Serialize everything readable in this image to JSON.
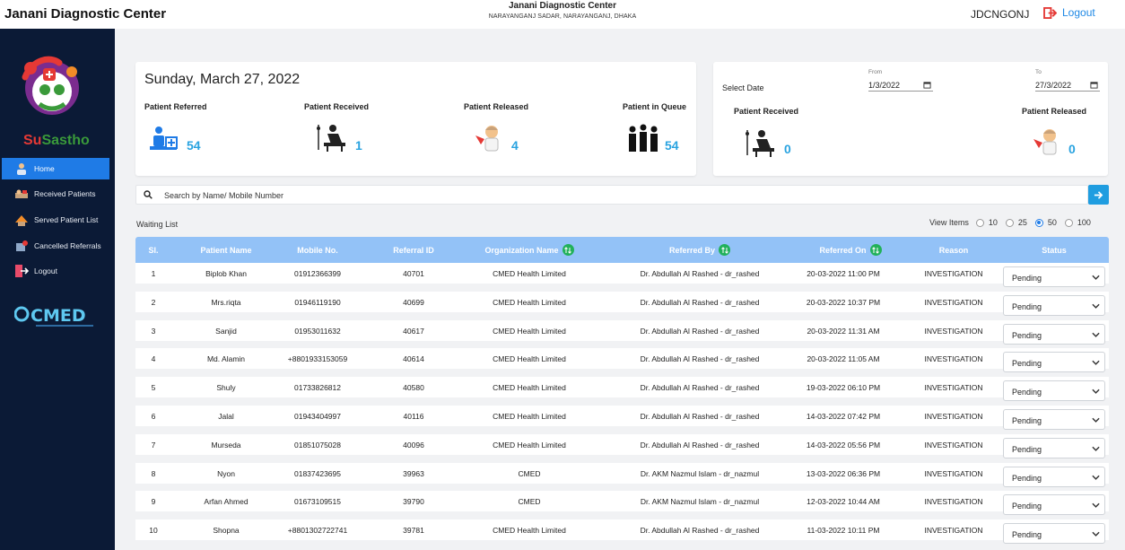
{
  "header": {
    "app_title": "Janani Diagnostic Center",
    "center_name": "Janani Diagnostic Center",
    "center_address": "NARAYANGANJ SADAR, NARAYANGANJ, DHAKA",
    "user_code": "JDCNGONJ",
    "logout_label": "Logout"
  },
  "sidebar": {
    "brand_a": "Su",
    "brand_b": "Sastho",
    "items": [
      {
        "label": "Home",
        "icon": "home-user-icon",
        "active": true
      },
      {
        "label": "Received Patients",
        "icon": "received-patients-icon"
      },
      {
        "label": "Served Patient List",
        "icon": "served-patient-icon"
      },
      {
        "label": "Cancelled Referrals",
        "icon": "cancelled-referrals-icon"
      },
      {
        "label": "Logout",
        "icon": "logout-icon"
      }
    ],
    "footer_logo": "CMED"
  },
  "summary": {
    "date": "Sunday, March 27, 2022",
    "stats": [
      {
        "label": "Patient Referred",
        "value": "54",
        "icon": "patient-referred-icon"
      },
      {
        "label": "Patient Received",
        "value": "1",
        "icon": "patient-received-icon"
      },
      {
        "label": "Patient Released",
        "value": "4",
        "icon": "patient-released-icon"
      },
      {
        "label": "Patient in Queue",
        "value": "54",
        "icon": "patient-queue-icon"
      }
    ]
  },
  "range": {
    "select_date_label": "Select Date",
    "from_label": "From",
    "from_value": "1/3/2022",
    "to_label": "To",
    "to_value": "27/3/2022",
    "received_label": "Patient Received",
    "received_value": "0",
    "released_label": "Patient Released",
    "released_value": "0"
  },
  "search": {
    "placeholder": "Search by Name/ Mobile Number"
  },
  "list": {
    "title": "Waiting List",
    "view_items_label": "View Items",
    "view_options": [
      "10",
      "25",
      "50",
      "100"
    ],
    "view_selected": "50"
  },
  "table": {
    "columns": [
      "Sl.",
      "Patient Name",
      "Mobile No.",
      "Referral ID",
      "Organization Name",
      "Referred By",
      "Referred On",
      "Reason",
      "Status"
    ],
    "rows": [
      {
        "sl": "1",
        "name": "Biplob Khan",
        "mobile": "01912366399",
        "ref_id": "40701",
        "org": "CMED Health Limited",
        "by": "Dr. Abdullah Al Rashed - dr_rashed",
        "on": "20-03-2022 11:00 PM",
        "reason": "INVESTIGATION",
        "status": "Pending"
      },
      {
        "sl": "2",
        "name": "Mrs.riqta",
        "mobile": "01946119190",
        "ref_id": "40699",
        "org": "CMED Health Limited",
        "by": "Dr. Abdullah Al Rashed - dr_rashed",
        "on": "20-03-2022 10:37 PM",
        "reason": "INVESTIGATION",
        "status": "Pending"
      },
      {
        "sl": "3",
        "name": "Sanjid",
        "mobile": "01953011632",
        "ref_id": "40617",
        "org": "CMED Health Limited",
        "by": "Dr. Abdullah Al Rashed - dr_rashed",
        "on": "20-03-2022 11:31 AM",
        "reason": "INVESTIGATION",
        "status": "Pending"
      },
      {
        "sl": "4",
        "name": "Md. Alamin",
        "mobile": "+8801933153059",
        "ref_id": "40614",
        "org": "CMED Health Limited",
        "by": "Dr. Abdullah Al Rashed - dr_rashed",
        "on": "20-03-2022 11:05 AM",
        "reason": "INVESTIGATION",
        "status": "Pending"
      },
      {
        "sl": "5",
        "name": "Shuly",
        "mobile": "01733826812",
        "ref_id": "40580",
        "org": "CMED Health Limited",
        "by": "Dr. Abdullah Al Rashed - dr_rashed",
        "on": "19-03-2022 06:10 PM",
        "reason": "INVESTIGATION",
        "status": "Pending"
      },
      {
        "sl": "6",
        "name": "Jalal",
        "mobile": "01943404997",
        "ref_id": "40116",
        "org": "CMED Health Limited",
        "by": "Dr. Abdullah Al Rashed - dr_rashed",
        "on": "14-03-2022 07:42 PM",
        "reason": "INVESTIGATION",
        "status": "Pending"
      },
      {
        "sl": "7",
        "name": "Murseda",
        "mobile": "01851075028",
        "ref_id": "40096",
        "org": "CMED Health Limited",
        "by": "Dr. Abdullah Al Rashed - dr_rashed",
        "on": "14-03-2022 05:56 PM",
        "reason": "INVESTIGATION",
        "status": "Pending"
      },
      {
        "sl": "8",
        "name": "Nyon",
        "mobile": "01837423695",
        "ref_id": "39963",
        "org": "CMED",
        "by": "Dr. AKM Nazmul Islam - dr_nazmul",
        "on": "13-03-2022 06:36 PM",
        "reason": "INVESTIGATION",
        "status": "Pending"
      },
      {
        "sl": "9",
        "name": "Arfan Ahmed",
        "mobile": "01673109515",
        "ref_id": "39790",
        "org": "CMED",
        "by": "Dr. AKM Nazmul Islam - dr_nazmul",
        "on": "12-03-2022 10:44 AM",
        "reason": "INVESTIGATION",
        "status": "Pending"
      },
      {
        "sl": "10",
        "name": "Shopna",
        "mobile": "+8801302722741",
        "ref_id": "39781",
        "org": "CMED Health Limited",
        "by": "Dr. Abdullah Al Rashed - dr_rashed",
        "on": "11-03-2022 10:11 PM",
        "reason": "INVESTIGATION",
        "status": "Pending"
      }
    ]
  },
  "colors": {
    "sidebar_bg": "#0b1a36",
    "active_nav": "#1f7be6",
    "table_header": "#93c2f7",
    "stat_value": "#29a3e0",
    "sort_badge": "#22b15a"
  }
}
